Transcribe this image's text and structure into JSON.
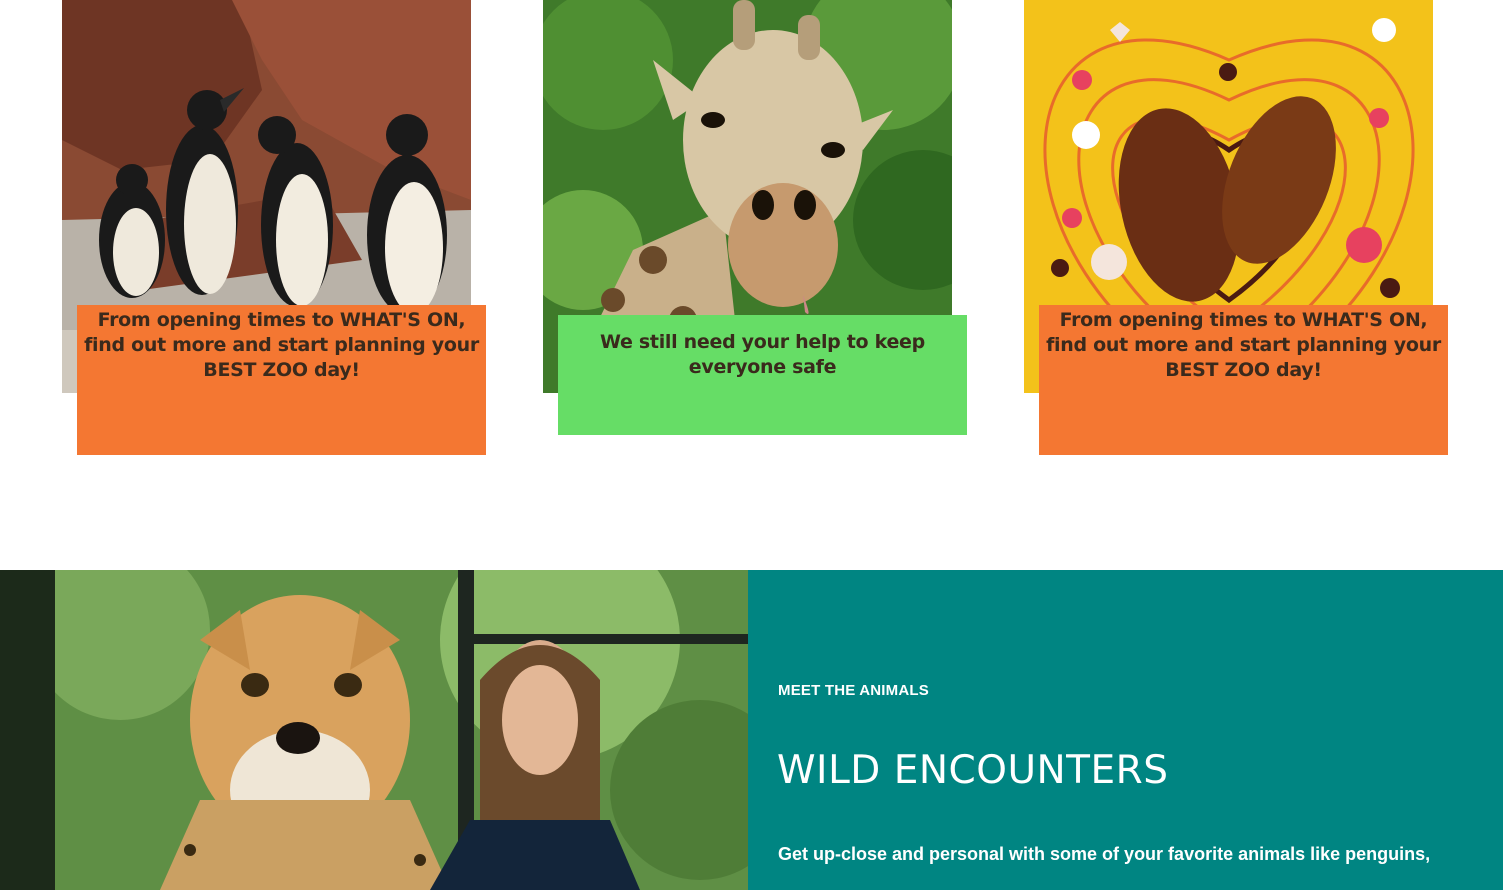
{
  "cards": [
    {
      "image_alt": "penguins",
      "caption": "From opening times to WHAT'S ON, find out more and start planning your BEST ZOO day!",
      "caption_color": "#f47732"
    },
    {
      "image_alt": "giraffe",
      "caption": "We still need your help to keep everyone safe",
      "caption_color": "#66dd66"
    },
    {
      "image_alt": "cockroaches-heart",
      "caption": "From opening times to WHAT'S ON, find out more and start planning your BEST ZOO day!",
      "caption_color": "#f47732"
    }
  ],
  "encounters": {
    "eyebrow": "MEET THE ANIMALS",
    "title": "WILD ENCOUNTERS",
    "lede": "Get up-close and personal with some of your favorite animals like penguins,",
    "panel_color": "#008582"
  }
}
